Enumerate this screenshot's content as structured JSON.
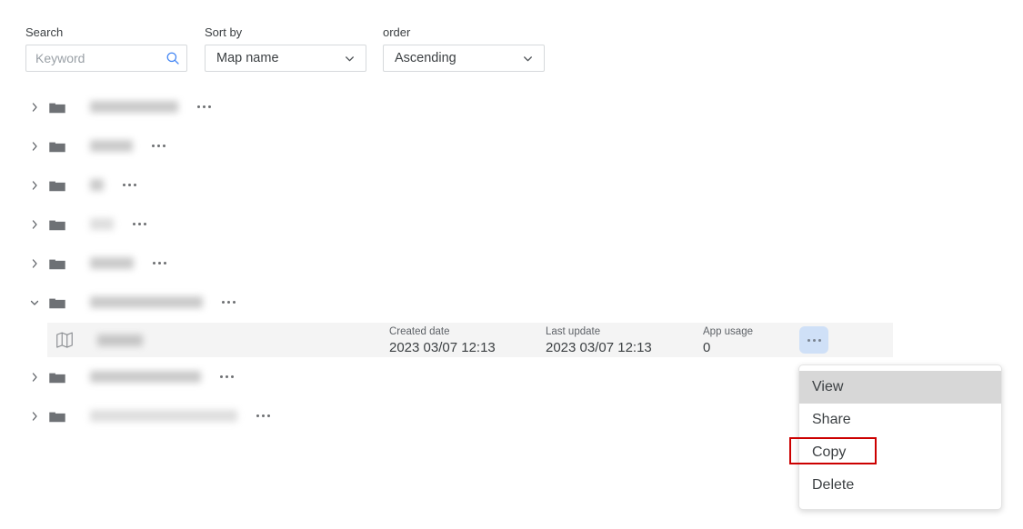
{
  "toolbar": {
    "search": {
      "label": "Search",
      "placeholder": "Keyword",
      "value": "",
      "icon": "search-icon",
      "icon_color": "#4285f4"
    },
    "sort_by": {
      "label": "Sort by",
      "selected": "Map name",
      "icon": "chevron-down-icon"
    },
    "order": {
      "label": "order",
      "selected": "Ascending",
      "icon": "chevron-down-icon"
    }
  },
  "tree": {
    "folders": [
      {
        "name": "",
        "redacted": true,
        "redacted_width": 97,
        "expanded": false,
        "icon": "folder-icon",
        "menu_icon": "ellipsis-icon"
      },
      {
        "name": "",
        "redacted": true,
        "redacted_width": 47,
        "expanded": false,
        "icon": "folder-icon",
        "menu_icon": "ellipsis-icon"
      },
      {
        "name": "",
        "redacted": true,
        "redacted_width": 15,
        "expanded": false,
        "icon": "folder-icon",
        "menu_icon": "ellipsis-icon"
      },
      {
        "name": "",
        "redacted": true,
        "redacted_width": 26,
        "expanded": false,
        "icon": "folder-icon",
        "menu_icon": "ellipsis-icon"
      },
      {
        "name": "",
        "redacted": true,
        "redacted_width": 48,
        "expanded": false,
        "icon": "folder-icon",
        "menu_icon": "ellipsis-icon"
      },
      {
        "name": "",
        "redacted": true,
        "redacted_width": 124,
        "expanded": true,
        "icon": "folder-icon",
        "menu_icon": "ellipsis-icon"
      },
      {
        "name": "",
        "redacted": true,
        "redacted_width": 122,
        "expanded": false,
        "icon": "folder-icon",
        "menu_icon": "ellipsis-icon"
      },
      {
        "name": "",
        "redacted": true,
        "redacted_width": 162,
        "expanded": false,
        "icon": "folder-icon",
        "menu_icon": "ellipsis-icon"
      }
    ]
  },
  "map_row": {
    "icon": "map-icon",
    "name": "",
    "redacted": true,
    "selected": true,
    "columns": [
      {
        "label": "Created date",
        "value": "2023 03/07 12:13"
      },
      {
        "label": "Last update",
        "value": "2023 03/07 12:13"
      },
      {
        "label": "App usage",
        "value": "0"
      }
    ],
    "action_button": {
      "icon": "ellipsis-icon",
      "active": true,
      "background": "#cfe0f7"
    }
  },
  "context_menu": {
    "open": true,
    "items": [
      {
        "label": "View",
        "hovered": true,
        "annotated": false
      },
      {
        "label": "Share",
        "hovered": false,
        "annotated": false
      },
      {
        "label": "Copy",
        "hovered": false,
        "annotated": true
      },
      {
        "label": "Delete",
        "hovered": false,
        "annotated": false
      }
    ],
    "annotation_color": "#cc0000"
  }
}
